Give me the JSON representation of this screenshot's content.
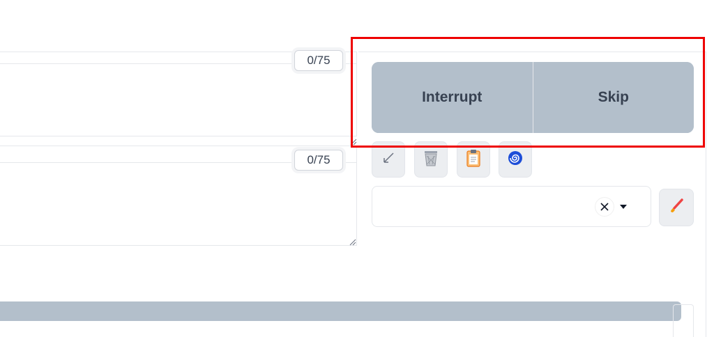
{
  "prompt": {
    "token_counter": "0/75"
  },
  "negative_prompt": {
    "token_counter": "0/75"
  },
  "actions": {
    "interrupt_label": "Interrupt",
    "skip_label": "Skip"
  },
  "tools": [
    {
      "name": "read-params-icon"
    },
    {
      "name": "trash-icon"
    },
    {
      "name": "clipboard-icon"
    },
    {
      "name": "spiral-icon"
    }
  ],
  "styles": {
    "value": ""
  },
  "colors": {
    "button_bg": "#b3bfcb",
    "highlight": "#ee0000",
    "spiral": "#1d4ed8",
    "clipboard": "#f97316"
  }
}
